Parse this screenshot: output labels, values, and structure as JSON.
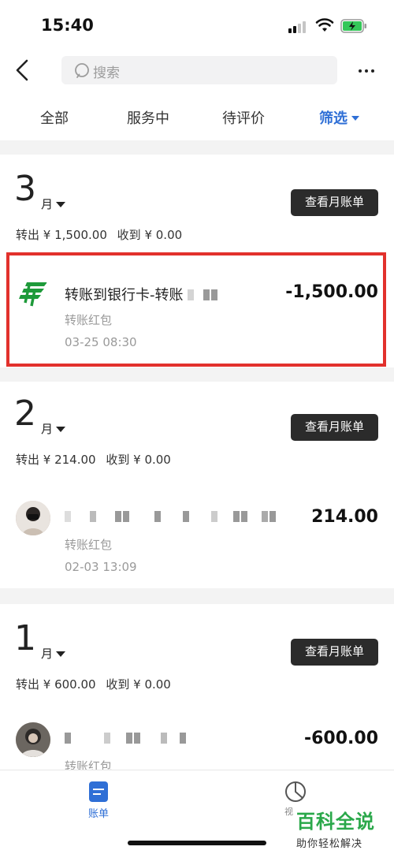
{
  "status": {
    "time": "15:40"
  },
  "header": {
    "search_placeholder": "搜索"
  },
  "tabs": [
    {
      "label": "全部"
    },
    {
      "label": "服务中"
    },
    {
      "label": "待评价"
    },
    {
      "label": "筛选"
    }
  ],
  "months": [
    {
      "number": "3",
      "unit": "月",
      "bill_button": "查看月账单",
      "out": "转出 ¥ 1,500.00",
      "in": "收到 ¥ 0.00",
      "txn": {
        "title": "转账到银行卡-转账",
        "type": "转账红包",
        "time": "03-25  08:30",
        "amount": "-1,500.00"
      }
    },
    {
      "number": "2",
      "unit": "月",
      "bill_button": "查看月账单",
      "out": "转出 ¥ 214.00",
      "in": "收到 ¥ 0.00",
      "txn": {
        "title": "",
        "type": "转账红包",
        "time": "02-03  13:09",
        "amount": "214.00"
      }
    },
    {
      "number": "1",
      "unit": "月",
      "bill_button": "查看月账单",
      "out": "转出 ¥ 600.00",
      "in": "收到 ¥ 0.00",
      "txn": {
        "title": "",
        "type": "转账红包",
        "time": "",
        "amount": "-600.00"
      }
    }
  ],
  "bottom_nav": {
    "bill_label": "账单",
    "stats_label": "视"
  },
  "watermark": {
    "main": "百科全说",
    "sub": "助你轻松解决"
  },
  "colors": {
    "accent": "#2f6fd6",
    "highlight": "#e2312c",
    "post_green": "#1e9a3a"
  }
}
